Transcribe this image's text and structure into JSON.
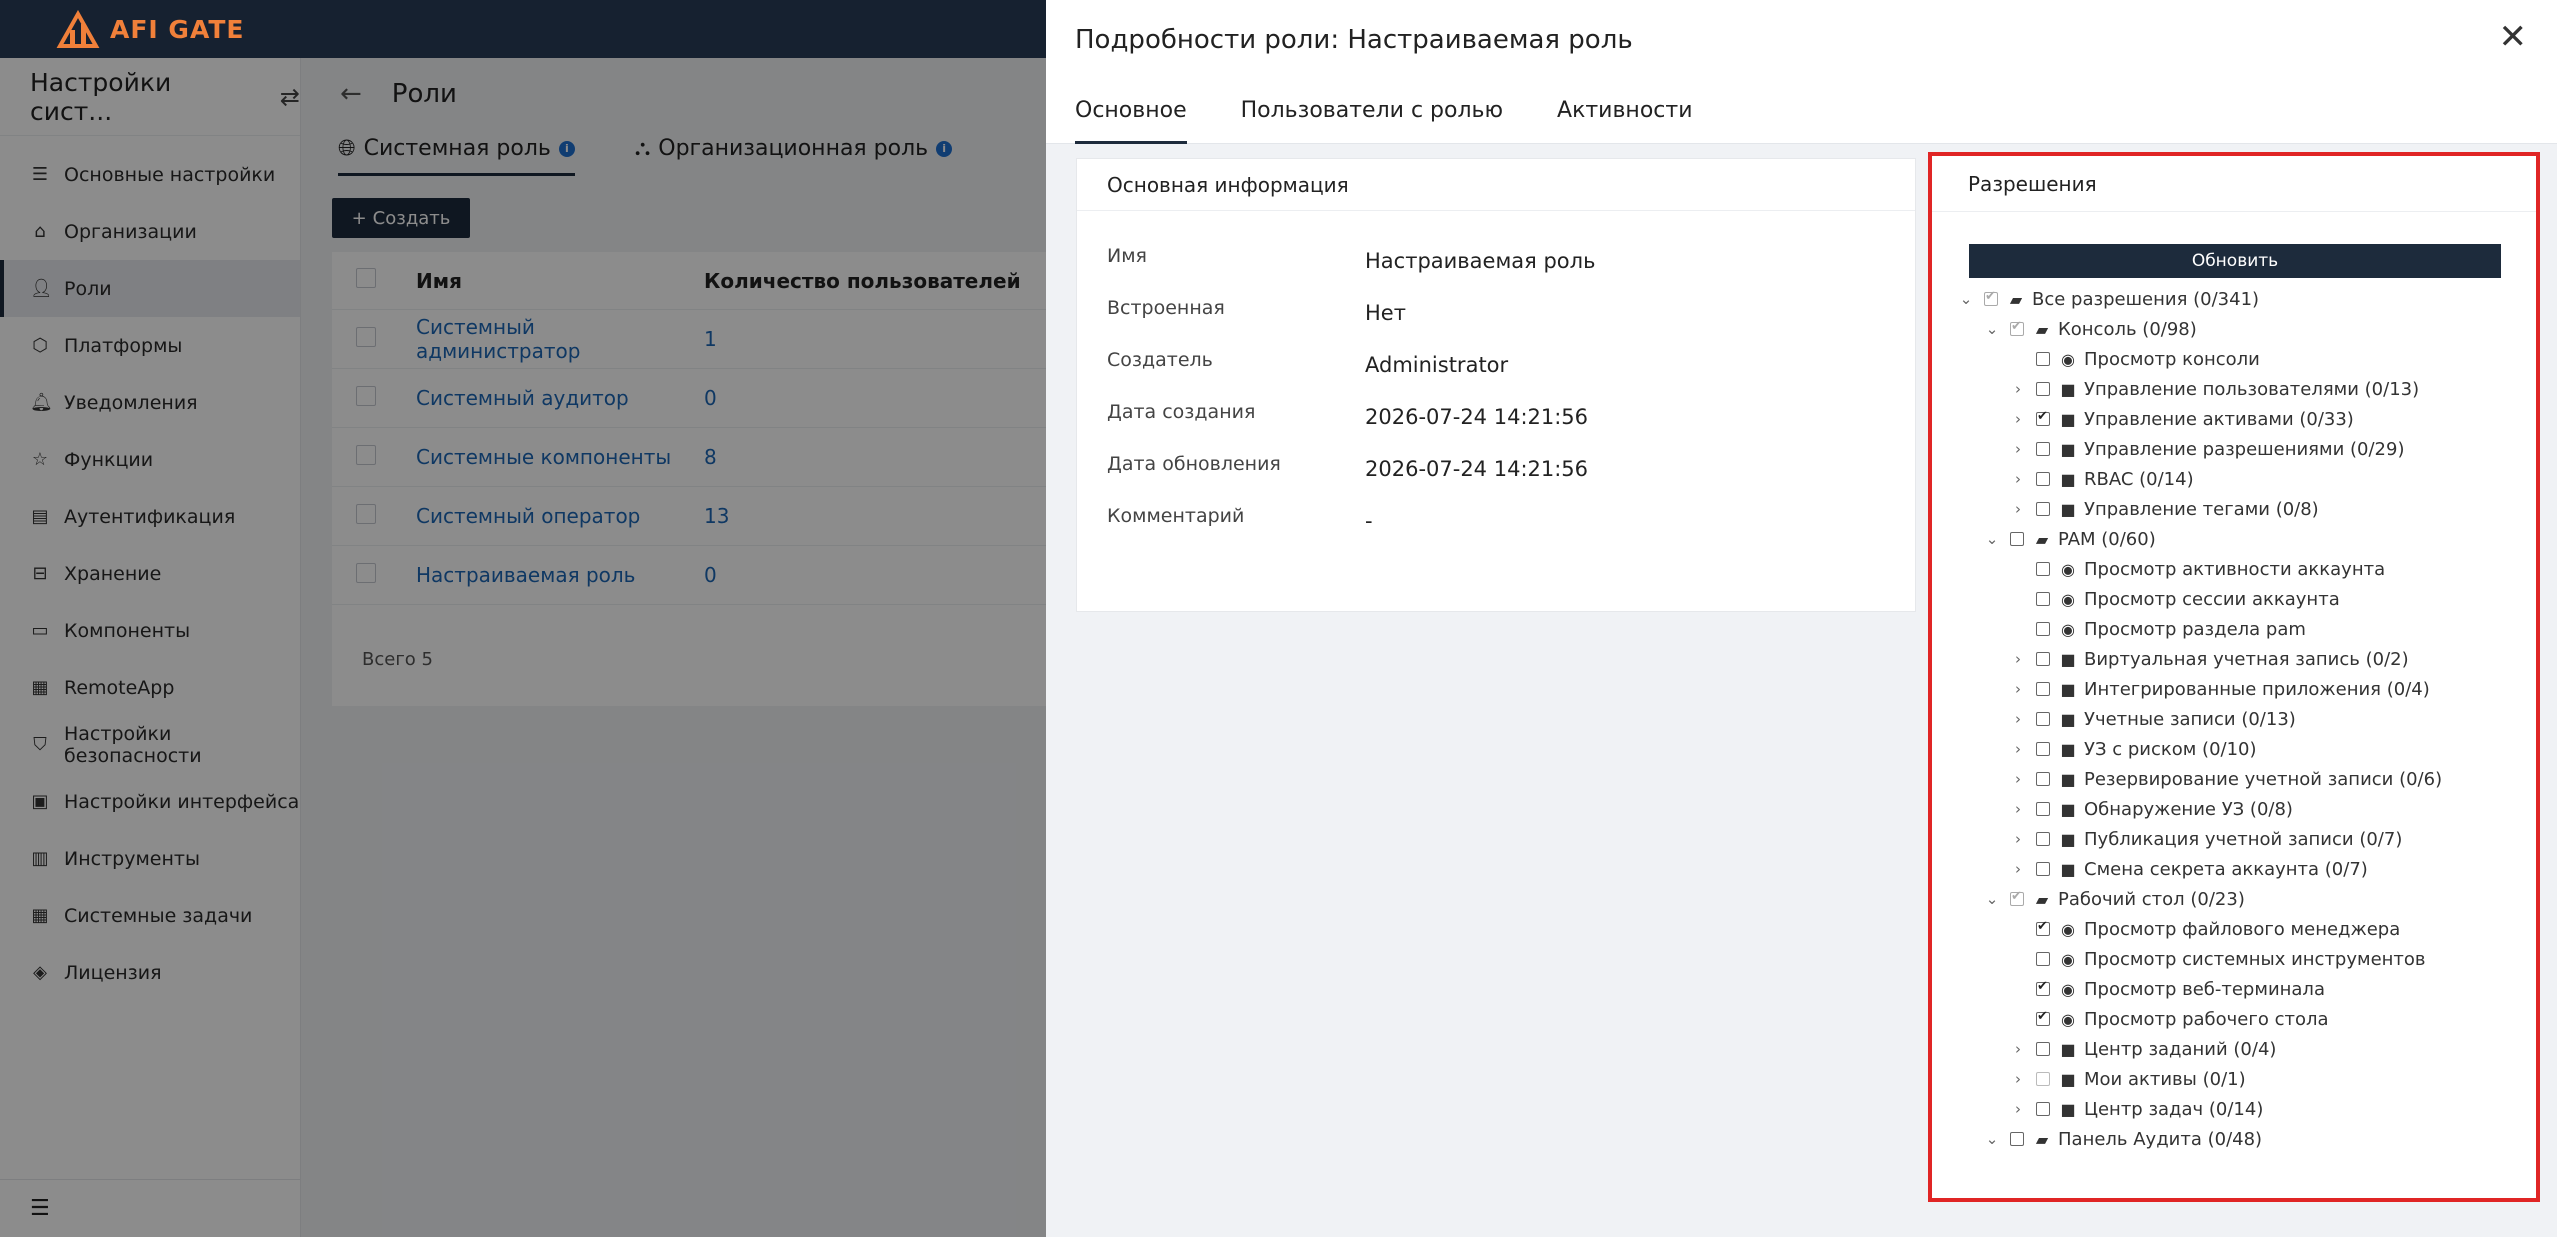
{
  "app": {
    "logo_text": "AFI GATE"
  },
  "sidebar": {
    "title": "Настройки сист...",
    "items": [
      {
        "label": "Основные настройки",
        "icon": "list-icon"
      },
      {
        "label": "Организации",
        "icon": "bank-icon"
      },
      {
        "label": "Роли",
        "icon": "user-icon",
        "active": true
      },
      {
        "label": "Платформы",
        "icon": "cube-icon"
      },
      {
        "label": "Уведомления",
        "icon": "bell-icon"
      },
      {
        "label": "Функции",
        "icon": "star-icon"
      },
      {
        "label": "Аутентификация",
        "icon": "id-card-icon"
      },
      {
        "label": "Хранение",
        "icon": "inbox-icon"
      },
      {
        "label": "Компоненты",
        "icon": "monitor-icon"
      },
      {
        "label": "RemoteApp",
        "icon": "grid-icon"
      },
      {
        "label": "Настройки безопасности",
        "icon": "shield-icon"
      },
      {
        "label": "Настройки интерфейса",
        "icon": "layout-icon"
      },
      {
        "label": "Инструменты",
        "icon": "briefcase-icon"
      },
      {
        "label": "Системные задачи",
        "icon": "table-icon"
      },
      {
        "label": "Лицензия",
        "icon": "badge-icon"
      }
    ]
  },
  "main": {
    "title": "Роли",
    "tabs": [
      {
        "label": "Системная роль",
        "icon": "globe-icon"
      },
      {
        "label": "Организационная роль",
        "icon": "sitemap-icon"
      }
    ],
    "create_label": "Создать",
    "table": {
      "headers": [
        "Имя",
        "Количество пользователей"
      ],
      "rows": [
        {
          "name": "Системный администратор",
          "count": "1"
        },
        {
          "name": "Системный аудитор",
          "count": "0"
        },
        {
          "name": "Системные компоненты",
          "count": "8"
        },
        {
          "name": "Системный оператор",
          "count": "13"
        },
        {
          "name": "Настраиваемая роль",
          "count": "0"
        }
      ],
      "total": "Всего 5"
    }
  },
  "drawer": {
    "title": "Подробности роли: Настраиваемая роль",
    "tabs": [
      "Основное",
      "Пользователи с ролью",
      "Активности"
    ],
    "basic": {
      "title": "Основная информация",
      "fields": [
        {
          "key": "Имя",
          "value": "Настраиваемая роль"
        },
        {
          "key": "Встроенная",
          "value": "Нет"
        },
        {
          "key": "Создатель",
          "value": "Administrator"
        },
        {
          "key": "Дата создания",
          "value": "2026-07-24 14:21:56"
        },
        {
          "key": "Дата обновления",
          "value": "2026-07-24 14:21:56"
        },
        {
          "key": "Комментарий",
          "value": "-"
        }
      ]
    },
    "permissions": {
      "title": "Разрешения",
      "refresh_label": "Обновить",
      "tree": [
        {
          "level": 0,
          "arrow": "down",
          "check": "partial",
          "icon": "folder-open-icon",
          "label": "Все разрешения (0/341)"
        },
        {
          "level": 1,
          "arrow": "down",
          "check": "partial",
          "icon": "folder-open-icon",
          "label": "Консоль (0/98)"
        },
        {
          "level": 2,
          "arrow": "none",
          "check": "empty",
          "icon": "eye-icon",
          "label": "Просмотр консоли"
        },
        {
          "level": 2,
          "arrow": "right",
          "check": "empty",
          "icon": "folder-icon",
          "label": "Управление пользователями (0/13)"
        },
        {
          "level": 2,
          "arrow": "right",
          "check": "checked",
          "icon": "folder-icon",
          "label": "Управление активами (0/33)"
        },
        {
          "level": 2,
          "arrow": "right",
          "check": "empty",
          "icon": "folder-icon",
          "label": "Управление разрешениями (0/29)"
        },
        {
          "level": 2,
          "arrow": "right",
          "check": "empty",
          "icon": "folder-icon",
          "label": "RBAC (0/14)"
        },
        {
          "level": 2,
          "arrow": "right",
          "check": "empty",
          "icon": "folder-icon",
          "label": "Управление тегами (0/8)"
        },
        {
          "level": 1,
          "arrow": "down",
          "check": "empty",
          "icon": "folder-open-icon",
          "label": "PAM (0/60)"
        },
        {
          "level": 2,
          "arrow": "none",
          "check": "empty",
          "icon": "eye-icon",
          "label": "Просмотр активности аккаунта"
        },
        {
          "level": 2,
          "arrow": "none",
          "check": "empty",
          "icon": "eye-icon",
          "label": "Просмотр сессии аккаунта"
        },
        {
          "level": 2,
          "arrow": "none",
          "check": "empty",
          "icon": "eye-icon",
          "label": "Просмотр раздела pam"
        },
        {
          "level": 2,
          "arrow": "right",
          "check": "empty",
          "icon": "folder-icon",
          "label": "Виртуальная учетная запись (0/2)"
        },
        {
          "level": 2,
          "arrow": "right",
          "check": "empty",
          "icon": "folder-icon",
          "label": "Интегрированные приложения (0/4)"
        },
        {
          "level": 2,
          "arrow": "right",
          "check": "empty",
          "icon": "folder-icon",
          "label": "Учетные записи (0/13)"
        },
        {
          "level": 2,
          "arrow": "right",
          "check": "empty",
          "icon": "folder-icon",
          "label": "УЗ с риском (0/10)"
        },
        {
          "level": 2,
          "arrow": "right",
          "check": "empty",
          "icon": "folder-icon",
          "label": "Резервирование учетной записи (0/6)"
        },
        {
          "level": 2,
          "arrow": "right",
          "check": "empty",
          "icon": "folder-icon",
          "label": "Обнаружение УЗ (0/8)"
        },
        {
          "level": 2,
          "arrow": "right",
          "check": "empty",
          "icon": "folder-icon",
          "label": "Публикация учетной записи (0/7)"
        },
        {
          "level": 2,
          "arrow": "right",
          "check": "empty",
          "icon": "folder-icon",
          "label": "Смена секрета аккаунта (0/7)"
        },
        {
          "level": 1,
          "arrow": "down",
          "check": "partial",
          "icon": "folder-open-icon",
          "label": "Рабочий стол (0/23)"
        },
        {
          "level": 2,
          "arrow": "none",
          "check": "checked",
          "icon": "eye-icon",
          "label": "Просмотр файлового менеджера"
        },
        {
          "level": 2,
          "arrow": "none",
          "check": "empty",
          "icon": "eye-icon",
          "label": "Просмотр системных инструментов"
        },
        {
          "level": 2,
          "arrow": "none",
          "check": "checked",
          "icon": "eye-icon",
          "label": "Просмотр веб-терминала"
        },
        {
          "level": 2,
          "arrow": "none",
          "check": "checked",
          "icon": "eye-icon",
          "label": "Просмотр рабочего стола"
        },
        {
          "level": 2,
          "arrow": "right",
          "check": "empty",
          "icon": "folder-icon",
          "label": "Центр заданий (0/4)"
        },
        {
          "level": 2,
          "arrow": "right",
          "check": "light",
          "icon": "folder-icon",
          "label": "Мои активы (0/1)"
        },
        {
          "level": 2,
          "arrow": "right",
          "check": "empty",
          "icon": "folder-icon",
          "label": "Центр задач (0/14)"
        },
        {
          "level": 1,
          "arrow": "down",
          "check": "empty",
          "icon": "folder-open-icon",
          "label": "Панель Аудита (0/48)"
        }
      ]
    }
  },
  "colors": {
    "topbar": "#162130",
    "brand_orange": "#f0803a",
    "primary_dark": "#1d2b3c",
    "link": "#1c66b5",
    "highlight_border": "#e02525"
  }
}
